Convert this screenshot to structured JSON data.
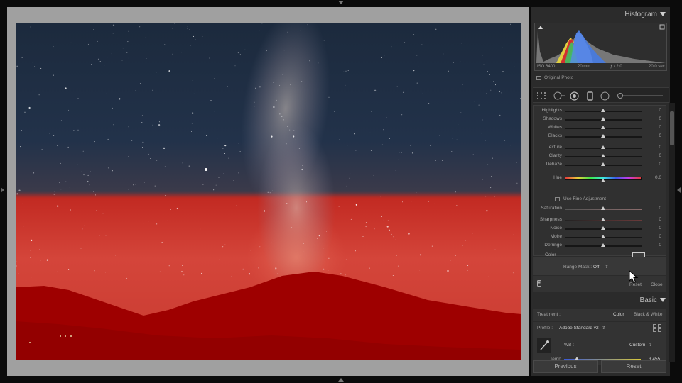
{
  "histogram": {
    "title": "Histogram",
    "iso": "ISO 6400",
    "focal": "20 mm",
    "aperture": "ƒ / 2.0",
    "shutter": "20.0 sec",
    "original_photo": "Original Photo"
  },
  "adjustments": {
    "rows": [
      {
        "label": "Highlights",
        "value": "0"
      },
      {
        "label": "Shadows",
        "value": "0"
      },
      {
        "label": "Whites",
        "value": "0"
      },
      {
        "label": "Blacks",
        "value": "0"
      },
      {
        "label": "Texture",
        "value": "0"
      },
      {
        "label": "Clarity",
        "value": "0"
      },
      {
        "label": "Dehaze",
        "value": "0"
      },
      {
        "label": "Hue",
        "value": "0.0"
      },
      {
        "label": "Saturation",
        "value": "0"
      },
      {
        "label": "Sharpness",
        "value": "0"
      },
      {
        "label": "Noise",
        "value": "0"
      },
      {
        "label": "Moire",
        "value": "0"
      },
      {
        "label": "Defringe",
        "value": "0"
      }
    ],
    "fine_adjustment": "Use Fine Adjustment",
    "color_label": "Color"
  },
  "range_mask": {
    "label": "Range Mask :",
    "value": "Off",
    "reset": "Reset",
    "close": "Close"
  },
  "basic": {
    "title": "Basic",
    "treatment_label": "Treatment :",
    "treatment_color": "Color",
    "treatment_bw": "Black & White",
    "profile_label": "Profile :",
    "profile_value": "Adobe Standard v2",
    "wb_label": "WB :",
    "wb_value": "Custom",
    "temp_label": "Temp",
    "temp_value": "3,455"
  },
  "buttons": {
    "previous": "Previous",
    "reset": "Reset"
  },
  "colors": {
    "mask_red": "#9e0000",
    "panel_bg": "#2b2b2b",
    "canvas_gray": "#a0a0a0"
  }
}
